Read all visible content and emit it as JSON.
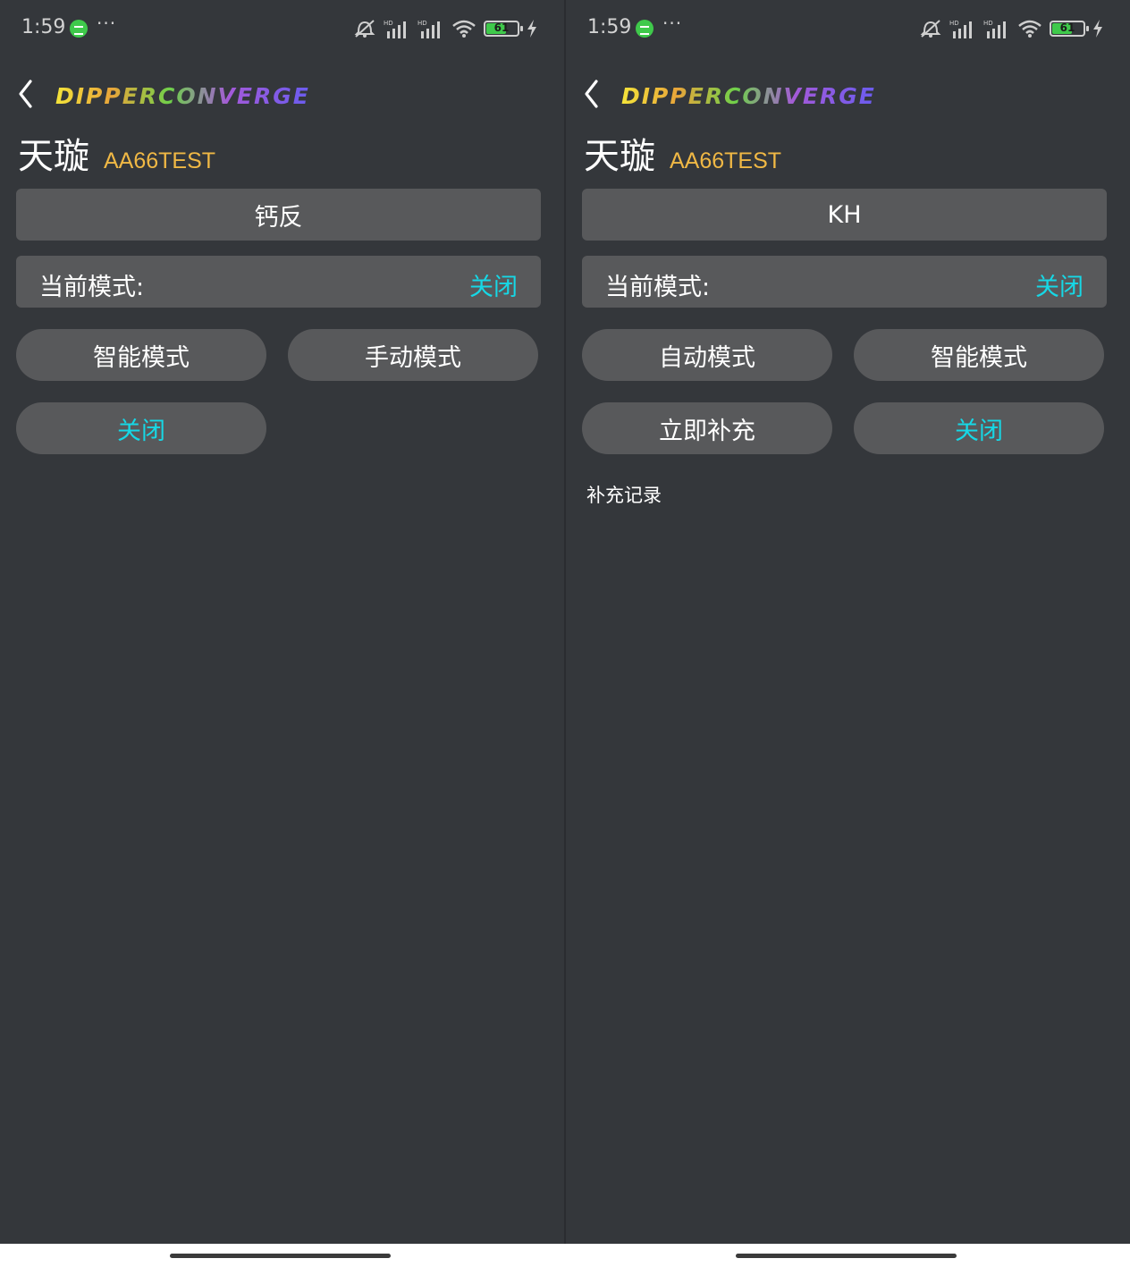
{
  "status_bar": {
    "time": "1:59",
    "dots": "···",
    "battery_level": "61"
  },
  "left": {
    "logo": "DIPPERCONVERGE",
    "device_name": "天璇",
    "device_id": "AA66TEST",
    "device_name_bar": "钙反",
    "current_mode_label": "当前模式:",
    "current_mode_value": "关闭",
    "buttons": [
      "智能模式",
      "手动模式",
      "关闭"
    ]
  },
  "right": {
    "logo": "DIPPERCONVERGE",
    "device_name": "天璇",
    "device_id": "AA66TEST",
    "device_name_bar": "KH",
    "current_mode_label": "当前模式:",
    "current_mode_value": "关闭",
    "buttons": [
      "自动模式",
      "智能模式",
      "立即补充",
      "关闭"
    ],
    "record_label": "补充记录"
  },
  "colors": {
    "background": "#34373b",
    "panel": "#58595b",
    "accent_cyan": "#16d8e6",
    "device_id_orange": "#f0b845",
    "battery_green": "#3fc94b"
  },
  "icons": [
    "back-chevron-icon",
    "message-icon",
    "mute-icon",
    "signal-icon",
    "wifi-icon",
    "battery-icon",
    "charging-icon"
  ]
}
